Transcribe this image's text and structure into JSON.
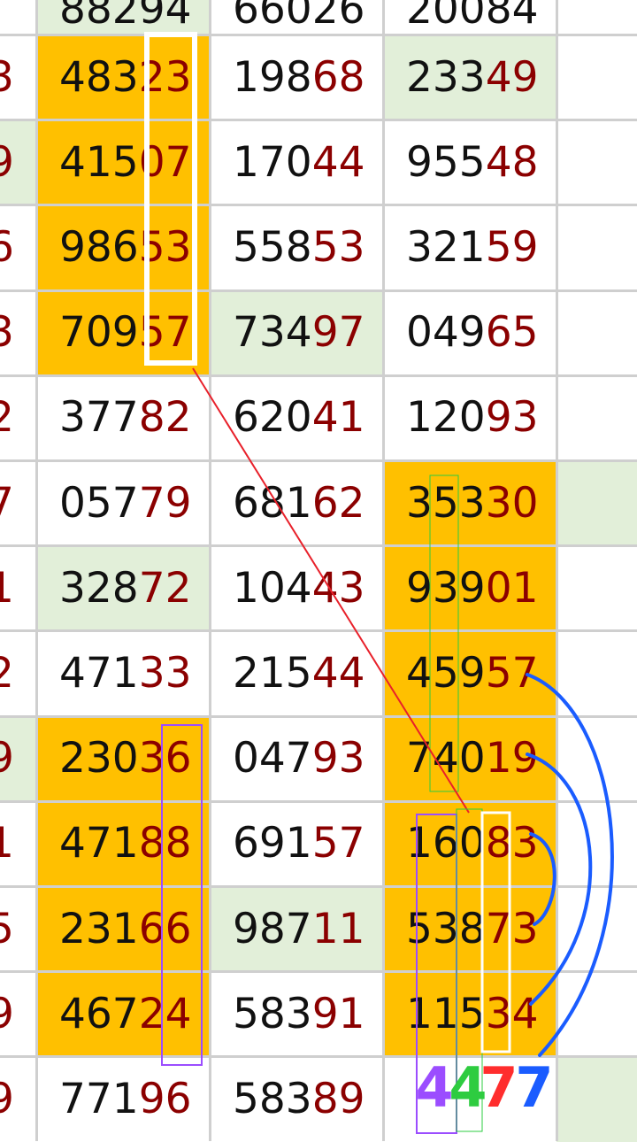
{
  "colors": {
    "highlight": "#ffc000",
    "light_green": "#e2efd9",
    "white": "#ffffff",
    "prefix_text": "#111111",
    "suffix_text": "#8b0000",
    "grid_line": "#cfcfcf"
  },
  "left_edge_digits": [
    "3",
    "9",
    "6",
    "3",
    "2",
    "7",
    "1",
    "2",
    "9",
    "1",
    "5",
    "9",
    "9"
  ],
  "partial_top_row": [
    "88294",
    "66026",
    "20084"
  ],
  "rows": [
    {
      "c1": {
        "prefix": "483",
        "suffix": "23",
        "bg": "highlight"
      },
      "c2": {
        "prefix": "198",
        "suffix": "68",
        "bg": "white"
      },
      "c3": {
        "prefix": "233",
        "suffix": "49",
        "bg": "light_green"
      },
      "c4_bg": "white",
      "left_bg": "white"
    },
    {
      "c1": {
        "prefix": "415",
        "suffix": "07",
        "bg": "highlight"
      },
      "c2": {
        "prefix": "170",
        "suffix": "44",
        "bg": "white"
      },
      "c3": {
        "prefix": "955",
        "suffix": "48",
        "bg": "white"
      },
      "c4_bg": "white",
      "left_bg": "light_green"
    },
    {
      "c1": {
        "prefix": "986",
        "suffix": "53",
        "bg": "highlight"
      },
      "c2": {
        "prefix": "558",
        "suffix": "53",
        "bg": "white"
      },
      "c3": {
        "prefix": "321",
        "suffix": "59",
        "bg": "white"
      },
      "c4_bg": "white",
      "left_bg": "white"
    },
    {
      "c1": {
        "prefix": "709",
        "suffix": "57",
        "bg": "highlight"
      },
      "c2": {
        "prefix": "734",
        "suffix": "97",
        "bg": "light_green"
      },
      "c3": {
        "prefix": "049",
        "suffix": "65",
        "bg": "white"
      },
      "c4_bg": "white",
      "left_bg": "white"
    },
    {
      "c1": {
        "prefix": "377",
        "suffix": "82",
        "bg": "white"
      },
      "c2": {
        "prefix": "620",
        "suffix": "41",
        "bg": "white"
      },
      "c3": {
        "prefix": "120",
        "suffix": "93",
        "bg": "white"
      },
      "c4_bg": "white",
      "left_bg": "white"
    },
    {
      "c1": {
        "prefix": "057",
        "suffix": "79",
        "bg": "white"
      },
      "c2": {
        "prefix": "681",
        "suffix": "62",
        "bg": "white"
      },
      "c3": {
        "prefix": "353",
        "suffix": "30",
        "bg": "highlight"
      },
      "c4_bg": "light_green",
      "left_bg": "white"
    },
    {
      "c1": {
        "prefix": "328",
        "suffix": "72",
        "bg": "light_green"
      },
      "c2": {
        "prefix": "104",
        "suffix": "43",
        "bg": "white"
      },
      "c3": {
        "prefix": "939",
        "suffix": "01",
        "bg": "highlight"
      },
      "c4_bg": "white",
      "left_bg": "white"
    },
    {
      "c1": {
        "prefix": "471",
        "suffix": "33",
        "bg": "white"
      },
      "c2": {
        "prefix": "215",
        "suffix": "44",
        "bg": "white"
      },
      "c3": {
        "prefix": "459",
        "suffix": "57",
        "bg": "highlight"
      },
      "c4_bg": "white",
      "left_bg": "white"
    },
    {
      "c1": {
        "prefix": "230",
        "suffix": "36",
        "bg": "highlight"
      },
      "c2": {
        "prefix": "047",
        "suffix": "93",
        "bg": "white"
      },
      "c3": {
        "prefix": "740",
        "suffix": "19",
        "bg": "highlight"
      },
      "c4_bg": "white",
      "left_bg": "light_green"
    },
    {
      "c1": {
        "prefix": "471",
        "suffix": "88",
        "bg": "highlight"
      },
      "c2": {
        "prefix": "691",
        "suffix": "57",
        "bg": "white"
      },
      "c3": {
        "prefix": "160",
        "suffix": "83",
        "bg": "highlight"
      },
      "c4_bg": "white",
      "left_bg": "white"
    },
    {
      "c1": {
        "prefix": "231",
        "suffix": "66",
        "bg": "highlight"
      },
      "c2": {
        "prefix": "987",
        "suffix": "11",
        "bg": "light_green"
      },
      "c3": {
        "prefix": "538",
        "suffix": "73",
        "bg": "highlight"
      },
      "c4_bg": "white",
      "left_bg": "white"
    },
    {
      "c1": {
        "prefix": "467",
        "suffix": "24",
        "bg": "highlight"
      },
      "c2": {
        "prefix": "583",
        "suffix": "91",
        "bg": "white"
      },
      "c3": {
        "prefix": "115",
        "suffix": "34",
        "bg": "highlight"
      },
      "c4_bg": "white",
      "left_bg": "white"
    },
    {
      "c1": {
        "prefix": "771",
        "suffix": "96",
        "bg": "white"
      },
      "c2": {
        "prefix": "583",
        "suffix": "89",
        "bg": "white"
      },
      "c3": {
        "prefix": "",
        "suffix": "",
        "bg": "white"
      },
      "c4_bg": "light_green",
      "left_bg": "white"
    }
  ],
  "handwritten_digits": [
    {
      "text": "4",
      "color": "#9b4dff"
    },
    {
      "text": "4",
      "color": "#2ecc40"
    },
    {
      "text": "7",
      "color": "#ff2d2d"
    },
    {
      "text": "7",
      "color": "#1a5cff"
    }
  ],
  "annotation_colors": {
    "white_box": "#ffffff",
    "purple_box": "#9b4dff",
    "green_box": "#2ecc40",
    "red_line": "#e8202a",
    "blue_curve": "#1a5cff"
  }
}
